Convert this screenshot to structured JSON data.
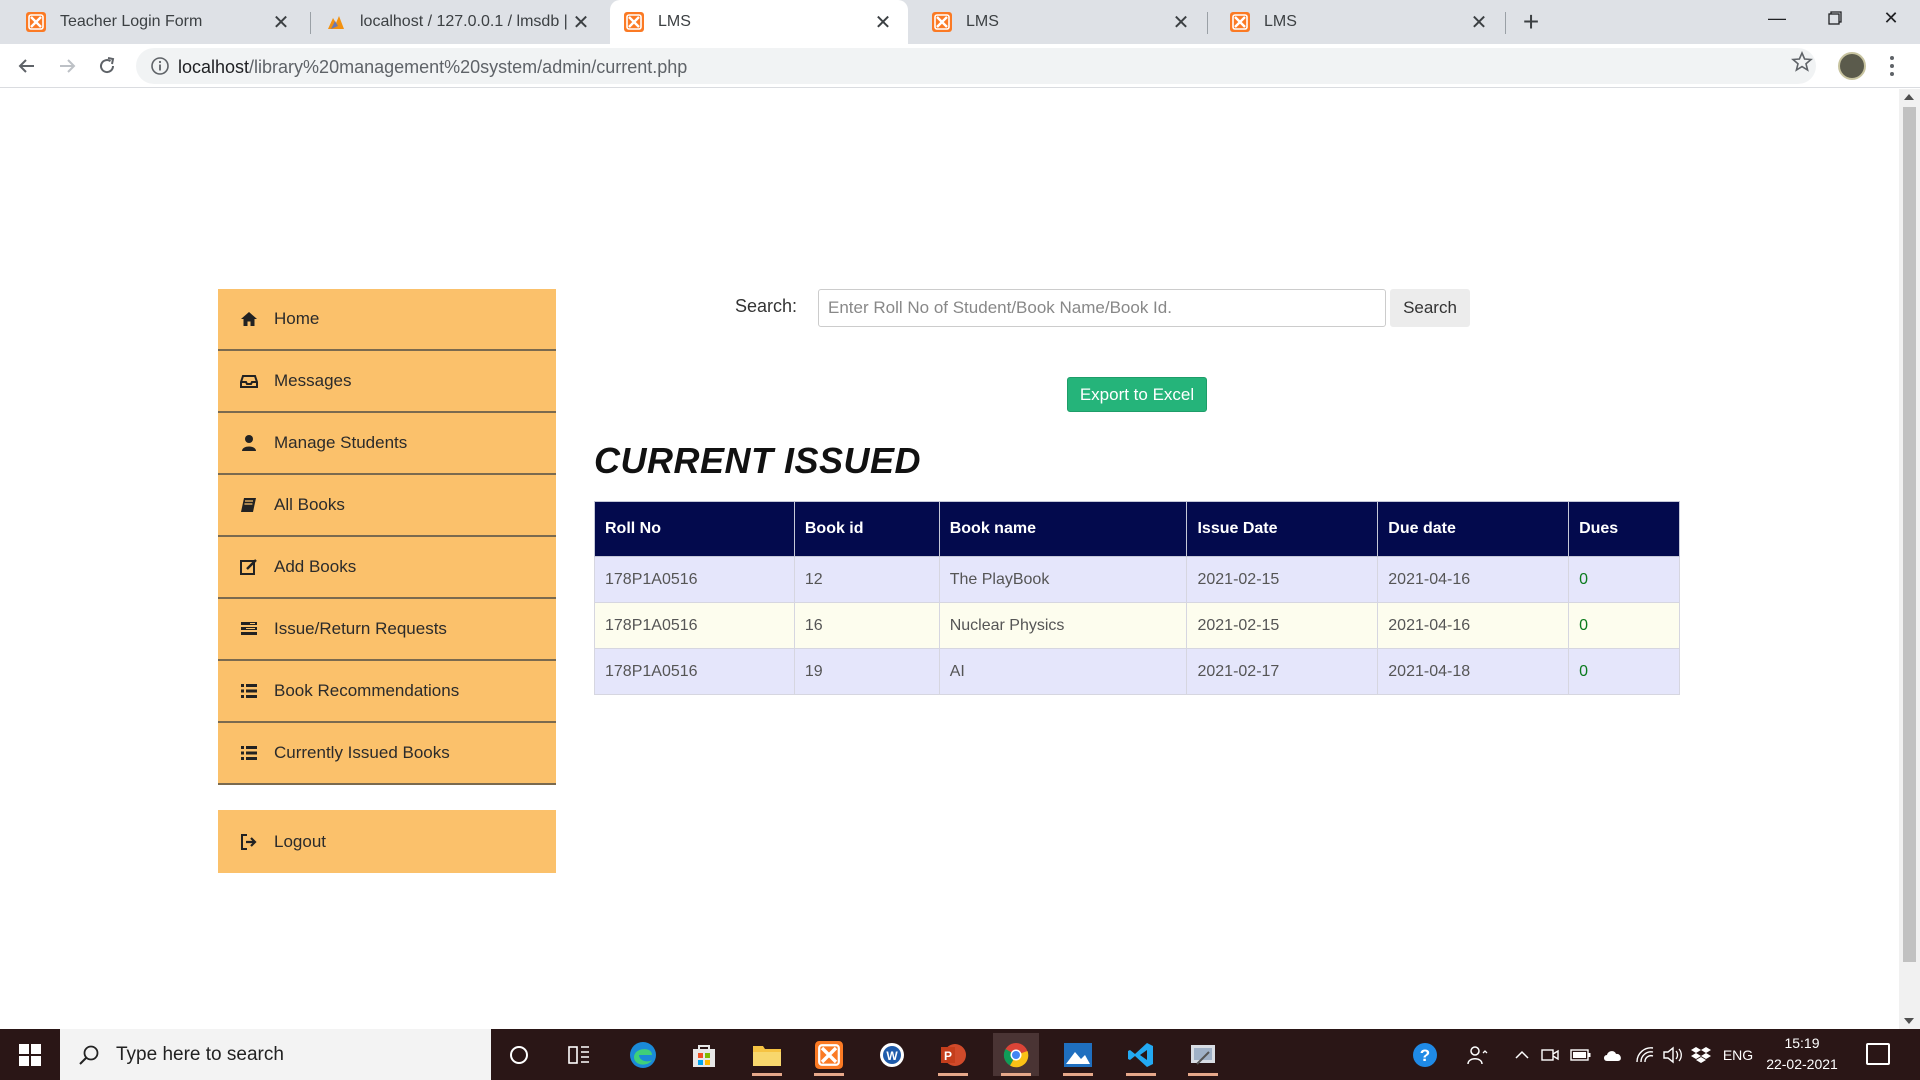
{
  "browser": {
    "tabs": [
      {
        "title": "Teacher Login Form",
        "active": false,
        "icon": "xampp-icon"
      },
      {
        "title": "localhost / 127.0.0.1 / lmsdb | php",
        "active": false,
        "icon": "phpmyadmin-icon"
      },
      {
        "title": "LMS",
        "active": true,
        "icon": "xampp-icon"
      },
      {
        "title": "LMS",
        "active": false,
        "icon": "xampp-icon"
      },
      {
        "title": "LMS",
        "active": false,
        "icon": "xampp-icon"
      }
    ],
    "url_host": "localhost",
    "url_path": "/library%20management%20system/admin/current.php"
  },
  "sidebar": {
    "items": [
      {
        "label": "Home",
        "icon": "home-icon"
      },
      {
        "label": "Messages",
        "icon": "inbox-icon"
      },
      {
        "label": "Manage Students",
        "icon": "user-icon"
      },
      {
        "label": "All Books",
        "icon": "book-icon"
      },
      {
        "label": "Add Books",
        "icon": "edit-icon"
      },
      {
        "label": "Issue/Return Requests",
        "icon": "tasks-icon"
      },
      {
        "label": "Book Recommendations",
        "icon": "list-icon"
      },
      {
        "label": "Currently Issued Books",
        "icon": "list-icon"
      }
    ],
    "logout_label": "Logout",
    "color": "#fbc16b"
  },
  "search": {
    "label": "Search:",
    "placeholder": "Enter Roll No of Student/Book Name/Book Id.",
    "value": "",
    "button_label": "Search"
  },
  "export_label": "Export to Excel",
  "page_title": "CURRENT ISSUED",
  "table": {
    "headers": [
      "Roll No",
      "Book id",
      "Book name",
      "Issue Date",
      "Due date",
      "Dues"
    ],
    "rows": [
      [
        "178P1A0516",
        "12",
        "The PlayBook",
        "2021-02-15",
        "2021-04-16",
        "0"
      ],
      [
        "178P1A0516",
        "16",
        "Nuclear Physics",
        "2021-02-15",
        "2021-04-16",
        "0"
      ],
      [
        "178P1A0516",
        "19",
        "AI",
        "2021-02-17",
        "2021-04-18",
        "0"
      ]
    ],
    "header_color": "#030a4d"
  },
  "taskbar": {
    "search_placeholder": "Type here to search",
    "language": "ENG",
    "time": "15:19",
    "date": "22-02-2021"
  }
}
